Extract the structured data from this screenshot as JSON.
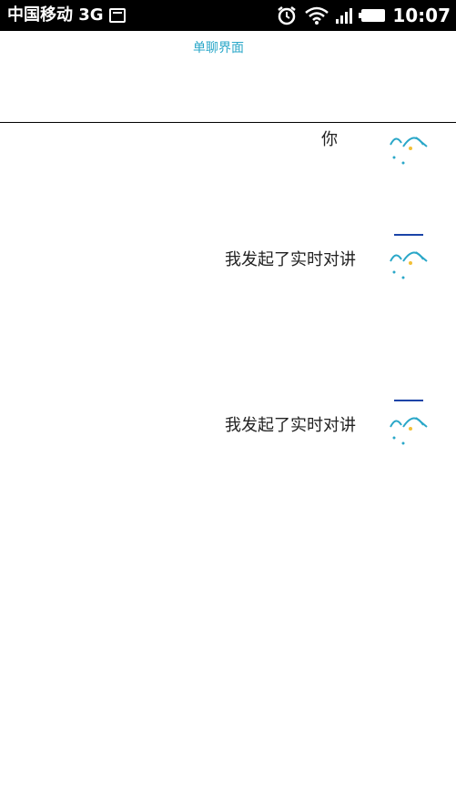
{
  "status_bar": {
    "carrier": "中国移动 3G",
    "time": "10:07",
    "icons": [
      "sim-icon",
      "alarm-icon",
      "wifi-icon",
      "signal-icon",
      "battery-icon"
    ]
  },
  "header": {
    "title": "单聊界面"
  },
  "messages": [
    {
      "text": "你"
    },
    {
      "text": "我发起了实时对讲"
    },
    {
      "text": "我发起了实时对讲"
    }
  ],
  "colors": {
    "status_bar_bg": "#000000",
    "accent": "#2aa7c8",
    "tick": "#1a44a8"
  }
}
